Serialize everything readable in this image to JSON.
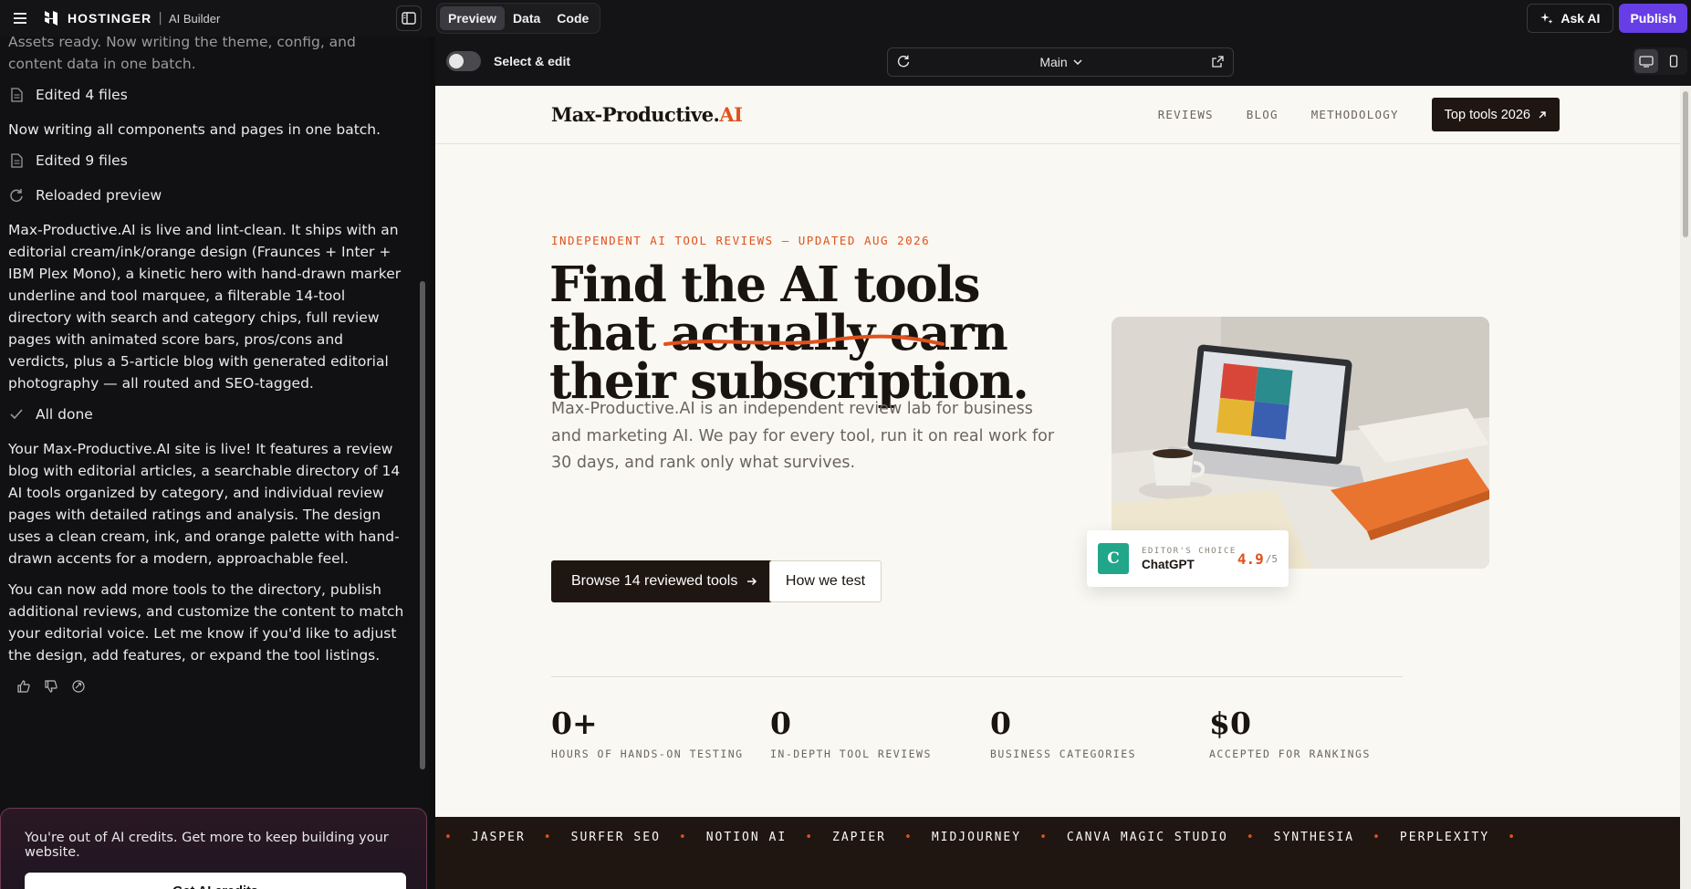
{
  "app": {
    "brand": "HOSTINGER",
    "product": "AI Builder",
    "tabs": [
      {
        "label": "Preview",
        "active": true
      },
      {
        "label": "Data",
        "active": false
      },
      {
        "label": "Code",
        "active": false
      }
    ],
    "ask_ai": "Ask AI",
    "publish": "Publish",
    "accent": "#673de6"
  },
  "chat": {
    "partial_top": "Assets ready. Now writing the theme, config, and content data in one batch.",
    "step1": "Edited 4 files",
    "msg1": "Now writing all components and pages in one batch.",
    "step2": "Edited 9 files",
    "step3": "Reloaded preview",
    "msg2": "Max-Productive.AI is live and lint-clean. It ships with an editorial cream/ink/orange design (Fraunces + Inter + IBM Plex Mono), a kinetic hero with hand-drawn marker underline and tool marquee, a filterable 14-tool directory with search and category chips, full review pages with animated score bars, pros/cons and verdicts, plus a 5-article blog with generated editorial photography — all routed and SEO-tagged.",
    "step4": "All done",
    "msg3": "Your Max-Productive.AI site is live! It features a review blog with editorial articles, a searchable directory of 14 AI tools organized by category, and individual review pages with detailed ratings and analysis. The design uses a clean cream, ink, and orange palette with hand-drawn accents for a modern, approachable feel.",
    "msg4": "You can now add more tools to the directory, publish additional reviews, and customize the content to match your editorial voice. Let me know if you'd like to adjust the design, add features, or expand the tool listings.",
    "credits_text": "You're out of AI credits. Get more to keep building your website.",
    "credits_button": "Get AI credits"
  },
  "preview_bar": {
    "select_edit": "Select & edit",
    "page": "Main"
  },
  "site": {
    "logo_main": "Max-Productive.",
    "logo_accent": "AI",
    "nav": [
      "REVIEWS",
      "BLOG",
      "METHODOLOGY"
    ],
    "nav_cta": "Top tools 2026",
    "eyebrow": "INDEPENDENT AI TOOL REVIEWS — UPDATED AUG 2026",
    "headline": [
      "Find the AI tools",
      "that actually earn",
      "their subscription."
    ],
    "lead": "Max-Productive.AI is an independent review lab for business and marketing AI. We pay for every tool, run it on real work for 30 days, and rank only what survives.",
    "btn_primary": "Browse 14 reviewed tools",
    "btn_secondary": "How we test",
    "badge": {
      "mark": "C",
      "eyebrow": "EDITOR'S CHOICE",
      "name": "ChatGPT",
      "score": "4.9",
      "of": "/5"
    },
    "stats": [
      {
        "value": "0+",
        "label": "HOURS OF HANDS-ON TESTING"
      },
      {
        "value": "0",
        "label": "IN-DEPTH TOOL REVIEWS"
      },
      {
        "value": "0",
        "label": "BUSINESS CATEGORIES"
      },
      {
        "value": "$0",
        "label": "ACCEPTED FOR RANKINGS"
      }
    ],
    "marquee": [
      "JASPER",
      "SURFER SEO",
      "NOTION AI",
      "ZAPIER",
      "MIDJOURNEY",
      "CANVA MAGIC STUDIO",
      "SYNTHESIA",
      "PERPLEXITY"
    ],
    "colors": {
      "ink": "#1f1612",
      "cream": "#faf8f3",
      "orange": "#e0521c"
    }
  }
}
